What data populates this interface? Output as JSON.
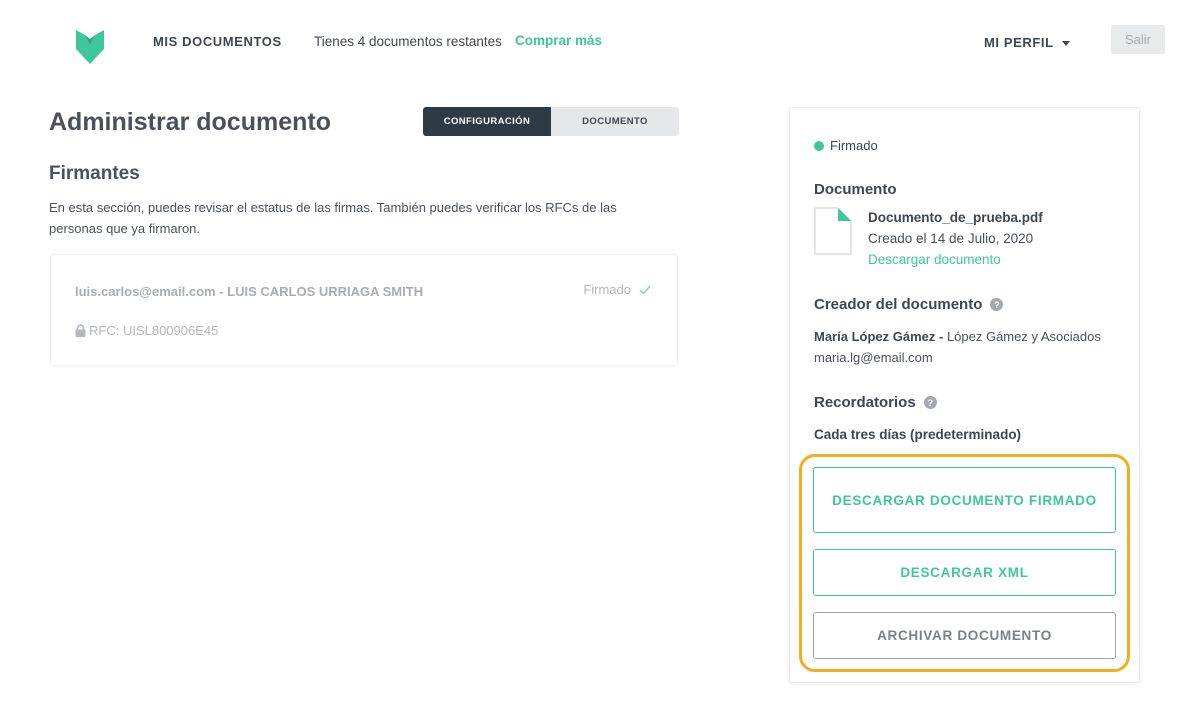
{
  "header": {
    "nav_docs": "MIS DOCUMENTOS",
    "remaining_text": "Tienes 4 documentos restantes",
    "buy_link": "Comprar más",
    "profile_label": "MI PERFIL",
    "exit_label": "Salir"
  },
  "main": {
    "title": "Administrar documento",
    "tabs": [
      {
        "label": "CONFIGURACIÓN",
        "active": true
      },
      {
        "label": "DOCUMENTO",
        "active": false
      }
    ],
    "signers_title": "Firmantes",
    "signers_desc": "En esta sección, puedes revisar el estatus de las firmas. También puedes verificar los RFCs de las personas que ya firmaron.",
    "signers": [
      {
        "identity": "luis.carlos@email.com - LUIS CARLOS URRIAGA SMITH",
        "rfc": "RFC: UISL800906E45",
        "status": "Firmado"
      }
    ]
  },
  "panel": {
    "status": "Firmado",
    "document_heading": "Documento",
    "file_name": "Documento_de_prueba.pdf",
    "file_date": "Creado el 14 de Julio, 2020",
    "download_link": "Descargar documento",
    "creator_heading": "Creador del documento",
    "creator_name": "María López Gámez -",
    "creator_company": "López Gámez y Asociados",
    "creator_email": "maria.lg@email.com",
    "reminders_heading": "Recordatorios",
    "reminders_value": "Cada tres días (predeterminado)",
    "buttons": {
      "download_signed": "DESCARGAR DOCUMENTO FIRMADO",
      "download_xml": "DESCARGAR XML",
      "archive": "ARCHIVAR DOCUMENTO"
    }
  },
  "colors": {
    "accent": "#3ec79a",
    "dark": "#2f3b44",
    "highlight": "#f2ae1c"
  },
  "icons": [
    "logo-icon",
    "caret-down-icon",
    "lock-icon",
    "check-icon",
    "status-dot-icon",
    "file-icon",
    "help-icon"
  ]
}
